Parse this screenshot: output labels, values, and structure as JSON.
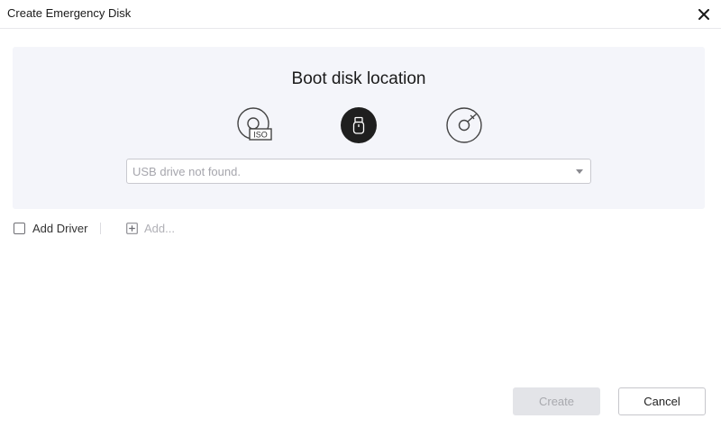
{
  "window": {
    "title": "Create Emergency Disk",
    "close_icon": "close-icon"
  },
  "boot_location": {
    "title": "Boot disk location",
    "options": [
      {
        "name": "iso",
        "icon": "iso-disc-icon",
        "badge": "ISO",
        "selected": false
      },
      {
        "name": "usb",
        "icon": "usb-drive-icon",
        "selected": true
      },
      {
        "name": "cd-dvd",
        "icon": "cd-dvd-icon",
        "selected": false
      }
    ],
    "dropdown": {
      "value": "USB drive not found."
    }
  },
  "driver": {
    "checkbox_label": "Add Driver",
    "checked": false,
    "add_label": "Add..."
  },
  "footer": {
    "create_label": "Create",
    "cancel_label": "Cancel"
  },
  "colors": {
    "panel_bg": "#f4f5fa",
    "selected_option_bg": "#1f1f1f",
    "disabled_button_bg": "#e3e4e8"
  }
}
